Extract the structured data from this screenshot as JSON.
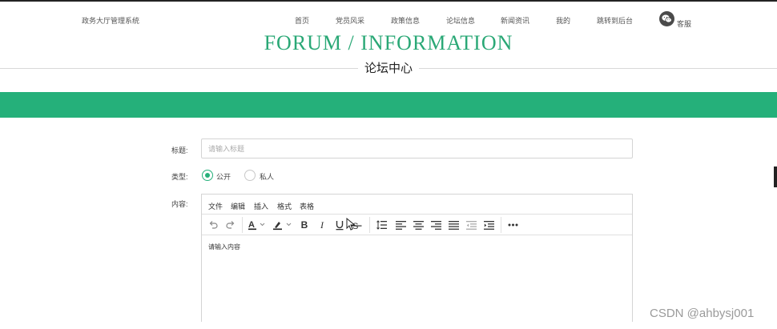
{
  "header": {
    "brand": "政务大厅管理系统",
    "nav": [
      {
        "label": "首页"
      },
      {
        "label": "党员风采"
      },
      {
        "label": "政策信息"
      },
      {
        "label": "论坛信息"
      },
      {
        "label": "新闻资讯"
      },
      {
        "label": "我的"
      },
      {
        "label": "跳转到后台"
      }
    ],
    "service": {
      "icon": "wechat-icon",
      "label": "客服"
    }
  },
  "hero": {
    "title_en": "FORUM / INFORMATION",
    "title_zh": "论坛中心",
    "band_color": "#25b07a"
  },
  "form": {
    "title": {
      "label": "标题:",
      "placeholder": "请输入标题",
      "value": ""
    },
    "type": {
      "label": "类型:",
      "options": [
        {
          "label": "公开",
          "checked": true
        },
        {
          "label": "私人",
          "checked": false
        }
      ]
    },
    "content": {
      "label": "内容:",
      "menu": [
        "文件",
        "编辑",
        "插入",
        "格式",
        "表格"
      ],
      "toolbar_icons": [
        "undo-icon",
        "redo-icon",
        "text-color-icon",
        "highlight-color-icon",
        "bold-icon",
        "italic-icon",
        "underline-icon",
        "strikethrough-icon",
        "line-height-icon",
        "align-left-icon",
        "align-center-icon",
        "align-right-icon",
        "justify-icon",
        "outdent-icon",
        "indent-icon",
        "more-icon"
      ],
      "body_text": "请输入内容"
    }
  },
  "accent_color": "#2aa876",
  "watermark": "CSDN @ahbysj001"
}
